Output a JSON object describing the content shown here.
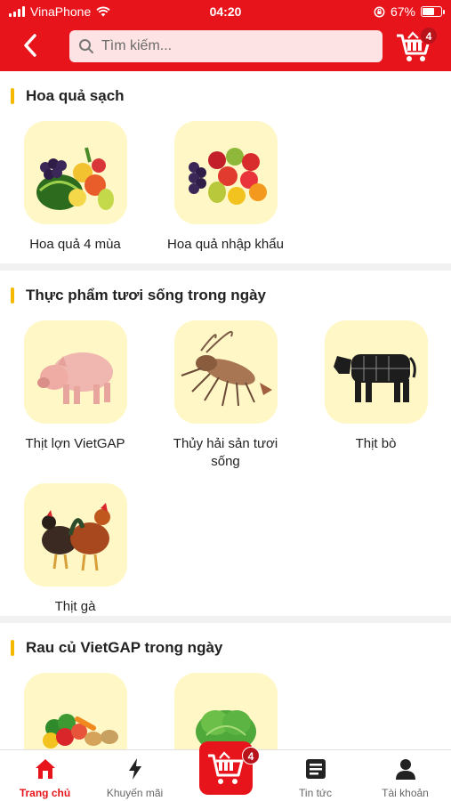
{
  "status_bar": {
    "carrier": "VinaPhone",
    "time": "04:20",
    "battery": "67%",
    "battery_level": 0.67
  },
  "header": {
    "back_icon": "chevron-left-icon",
    "search_placeholder": "Tìm kiếm...",
    "cart_count": "4",
    "accent_color": "#e8141c"
  },
  "sections": [
    {
      "title": "Hoa quả sạch",
      "items": [
        {
          "label": "Hoa quả 4 mùa",
          "image": "mixed-fruit-basket"
        },
        {
          "label": "Hoa quả nhập khẩu",
          "image": "imported-fruits"
        }
      ]
    },
    {
      "title": "Thực phẩm tươi sống trong ngày",
      "items": [
        {
          "label": "Thịt lợn VietGAP",
          "image": "pig"
        },
        {
          "label": "Thủy hải sản tươi sống",
          "image": "lobster"
        },
        {
          "label": "Thịt bò",
          "image": "beef-cow"
        },
        {
          "label": "Thịt gà",
          "image": "chickens"
        }
      ]
    },
    {
      "title": "Rau củ VietGAP trong ngày",
      "items": [
        {
          "label": "",
          "image": "mixed-vegetables"
        },
        {
          "label": "",
          "image": "lettuce"
        }
      ]
    }
  ],
  "bottom_nav": {
    "items": [
      {
        "label": "Trang chủ",
        "icon": "home-icon",
        "active": true
      },
      {
        "label": "Khuyến mãi",
        "icon": "lightning-icon",
        "active": false
      },
      {
        "label": "Tin tức",
        "icon": "news-icon",
        "active": false
      },
      {
        "label": "Tài khoản",
        "icon": "account-icon",
        "active": false
      }
    ],
    "cart_count": "4"
  }
}
